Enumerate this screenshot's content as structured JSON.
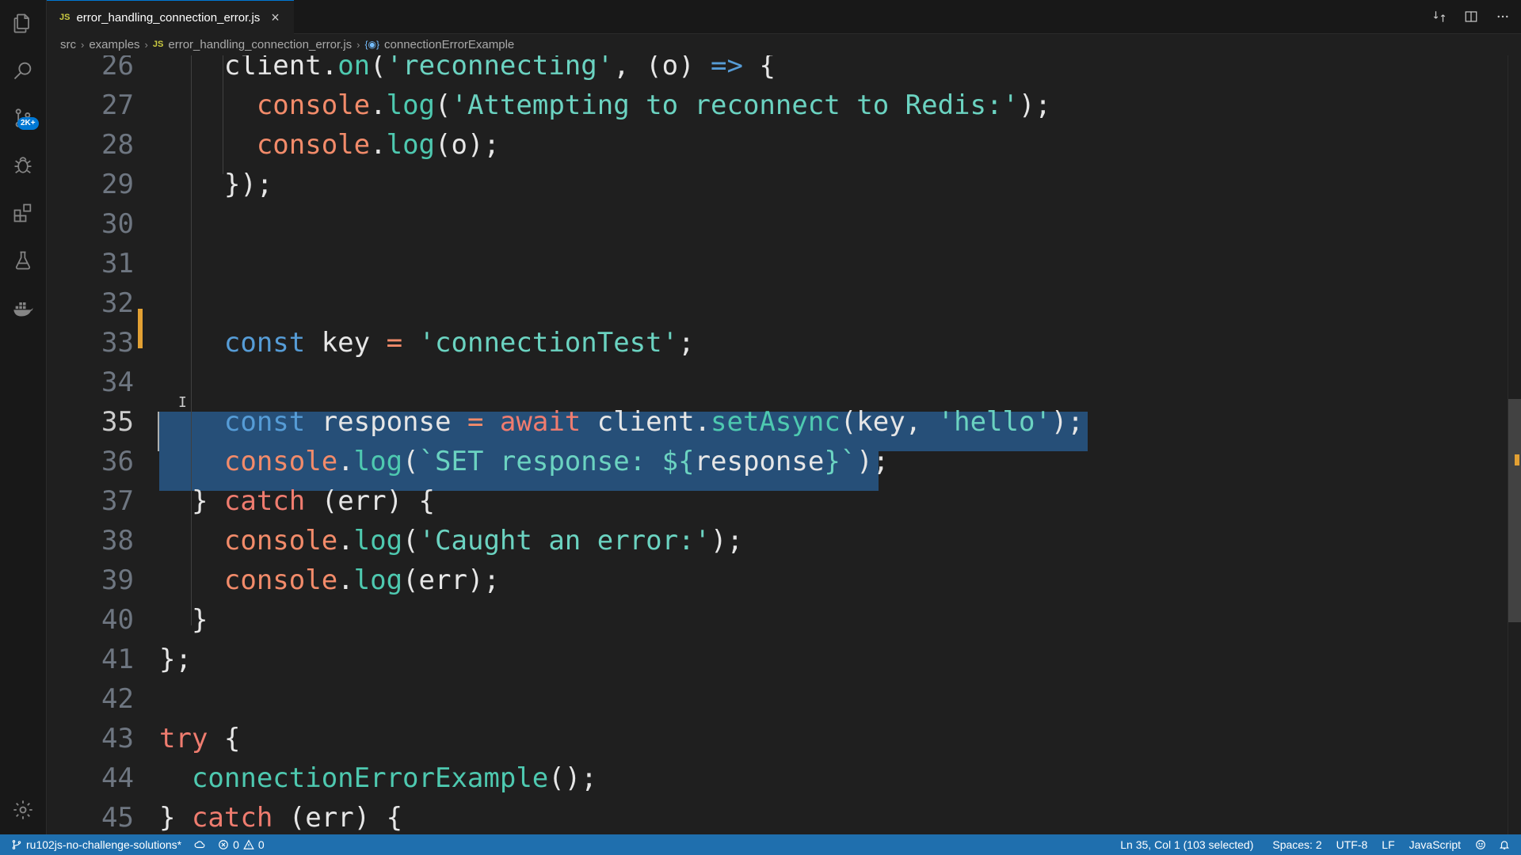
{
  "tab": {
    "file_badge": "JS",
    "file_name": "error_handling_connection_error.js",
    "close": "×"
  },
  "breadcrumb": {
    "items": [
      "src",
      "examples",
      "error_handling_connection_error.js",
      "connectionErrorExample"
    ],
    "file_badge": "JS",
    "symbol_icon": "{◉}"
  },
  "activity": {
    "scm_badge": "2K+",
    "icons": [
      "explorer-icon",
      "search-icon",
      "source-control-icon",
      "debug-icon",
      "extensions-icon",
      "testing-icon",
      "docker-icon",
      "settings-gear-icon"
    ]
  },
  "editor": {
    "active_line": 35,
    "lines": [
      {
        "n": "26",
        "tokens": [
          {
            "t": "    client",
            "c": "var"
          },
          {
            "t": ".",
            "c": "var"
          },
          {
            "t": "on",
            "c": "fn"
          },
          {
            "t": "(",
            "c": "var"
          },
          {
            "t": "'reconnecting'",
            "c": "str"
          },
          {
            "t": ", (o) ",
            "c": "var"
          },
          {
            "t": "=>",
            "c": "arrow"
          },
          {
            "t": " {",
            "c": "var"
          }
        ]
      },
      {
        "n": "27",
        "tokens": [
          {
            "t": "      console",
            "c": "obj"
          },
          {
            "t": ".",
            "c": "var"
          },
          {
            "t": "log",
            "c": "fn"
          },
          {
            "t": "(",
            "c": "var"
          },
          {
            "t": "'Attempting to reconnect to Redis:'",
            "c": "str"
          },
          {
            "t": ");",
            "c": "var"
          }
        ]
      },
      {
        "n": "28",
        "tokens": [
          {
            "t": "      console",
            "c": "obj"
          },
          {
            "t": ".",
            "c": "var"
          },
          {
            "t": "log",
            "c": "fn"
          },
          {
            "t": "(o);",
            "c": "var"
          }
        ]
      },
      {
        "n": "29",
        "tokens": [
          {
            "t": "    });",
            "c": "var"
          }
        ]
      },
      {
        "n": "30",
        "tokens": []
      },
      {
        "n": "31",
        "tokens": []
      },
      {
        "n": "32",
        "tokens": []
      },
      {
        "n": "33",
        "tokens": [
          {
            "t": "    const",
            "c": "kw"
          },
          {
            "t": " key ",
            "c": "var"
          },
          {
            "t": "=",
            "c": "op"
          },
          {
            "t": " ",
            "c": "var"
          },
          {
            "t": "'connectionTest'",
            "c": "str"
          },
          {
            "t": ";",
            "c": "var"
          }
        ]
      },
      {
        "n": "34",
        "tokens": []
      },
      {
        "n": "35",
        "tokens": [
          {
            "t": "    const",
            "c": "kw"
          },
          {
            "t": " response ",
            "c": "var"
          },
          {
            "t": "=",
            "c": "op"
          },
          {
            "t": " ",
            "c": "var"
          },
          {
            "t": "await",
            "c": "ctl"
          },
          {
            "t": " client.",
            "c": "var"
          },
          {
            "t": "setAsync",
            "c": "fn"
          },
          {
            "t": "(key, ",
            "c": "var"
          },
          {
            "t": "'hello'",
            "c": "str"
          },
          {
            "t": ");",
            "c": "var"
          }
        ]
      },
      {
        "n": "36",
        "tokens": [
          {
            "t": "    console",
            "c": "obj"
          },
          {
            "t": ".",
            "c": "var"
          },
          {
            "t": "log",
            "c": "fn"
          },
          {
            "t": "(",
            "c": "var"
          },
          {
            "t": "`SET response: ${",
            "c": "str"
          },
          {
            "t": "response",
            "c": "var"
          },
          {
            "t": "}`",
            "c": "str"
          },
          {
            "t": ");",
            "c": "var"
          }
        ]
      },
      {
        "n": "37",
        "tokens": [
          {
            "t": "  } ",
            "c": "var"
          },
          {
            "t": "catch",
            "c": "ctl"
          },
          {
            "t": " (err) {",
            "c": "var"
          }
        ]
      },
      {
        "n": "38",
        "tokens": [
          {
            "t": "    console",
            "c": "obj"
          },
          {
            "t": ".",
            "c": "var"
          },
          {
            "t": "log",
            "c": "fn"
          },
          {
            "t": "(",
            "c": "var"
          },
          {
            "t": "'Caught an error:'",
            "c": "str"
          },
          {
            "t": ");",
            "c": "var"
          }
        ]
      },
      {
        "n": "39",
        "tokens": [
          {
            "t": "    console",
            "c": "obj"
          },
          {
            "t": ".",
            "c": "var"
          },
          {
            "t": "log",
            "c": "fn"
          },
          {
            "t": "(err);",
            "c": "var"
          }
        ]
      },
      {
        "n": "40",
        "tokens": [
          {
            "t": "  }",
            "c": "var"
          }
        ]
      },
      {
        "n": "41",
        "tokens": [
          {
            "t": "};",
            "c": "var"
          }
        ]
      },
      {
        "n": "42",
        "tokens": []
      },
      {
        "n": "43",
        "tokens": [
          {
            "t": "try",
            "c": "ctl"
          },
          {
            "t": " {",
            "c": "var"
          }
        ]
      },
      {
        "n": "44",
        "tokens": [
          {
            "t": "  connectionErrorExample",
            "c": "fn"
          },
          {
            "t": "();",
            "c": "var"
          }
        ]
      },
      {
        "n": "45",
        "tokens": [
          {
            "t": "} ",
            "c": "var"
          },
          {
            "t": "catch",
            "c": "ctl"
          },
          {
            "t": " (err) {",
            "c": "var"
          }
        ]
      }
    ]
  },
  "statusbar": {
    "branch": "ru102js-no-challenge-solutions*",
    "errors": "0",
    "warnings": "0",
    "cursor": "Ln 35, Col 1 (103 selected)",
    "spaces": "Spaces: 2",
    "encoding": "UTF-8",
    "eol": "LF",
    "language": "JavaScript"
  },
  "colors": {
    "statusbar": "#1f6fae",
    "selection": "#264f78",
    "modified_gutter": "#e2a033"
  }
}
